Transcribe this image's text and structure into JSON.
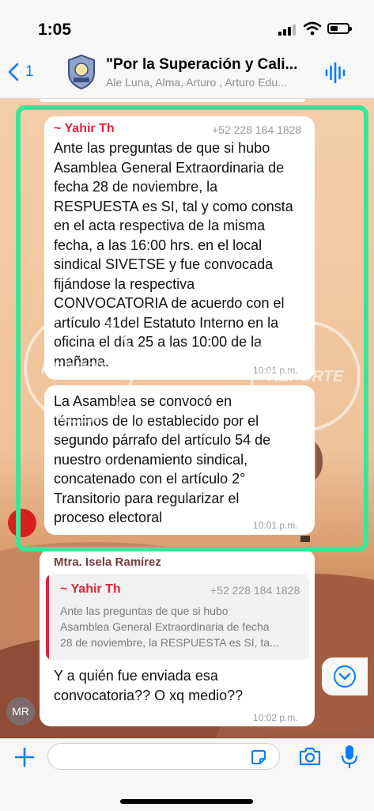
{
  "status_bar": {
    "time": "1:05"
  },
  "header": {
    "back_count": "1",
    "group_title": "\"Por la Superación y Cali...",
    "members": "Ale Luna, Alma, Arturo , Arturo Edu..."
  },
  "messages": {
    "m1": {
      "sender": "~ Yahir Th",
      "phone": "+52 228 184 1828",
      "text": "Ante las preguntas de que si hubo\nAsamblea General Extraordinaria de\nfecha 28 de noviembre, la\nRESPUESTA es SI, tal y como consta\nen el acta respectiva de la misma\nfecha,  a las 16:00 hrs. en el local\nsindical SIVETSE y fue convocada\nfijándose la respectiva\nCONVOCATORIA de acuerdo con el\nartículo 41del Estatuto Interno  en la\noficina el día 25 a las 10:00 de la\nmañana.",
      "time": "10:01 p.m."
    },
    "m2": {
      "text": "La Asamblea se convocó en\ntérminos de lo establecido por el\nsegundo párrafo del artículo 54 de\nnuestro ordenamiento sindical,\nconcatenado con el artículo 2°\nTransitorio para regularizar el\nproceso electoral",
      "time": "10:01 p.m."
    },
    "m3": {
      "sender": "Mtra. Isela Ramírez",
      "quoted_sender": "~ Yahir Th",
      "quoted_phone": "+52 228 184 1828",
      "quoted_text": "Ante las preguntas de que si hubo\nAsamblea General Extraordinaria de fecha\n28 de noviembre, la RESPUESTA es SI, ta...",
      "text": "Y a quién fue enviada esa\nconvocatoria?? O xq medio??",
      "time": "10:02 p.m.",
      "avatar_initials": "MR"
    }
  },
  "colors": {
    "accent": "#0a7cff",
    "sender_red": "#e0243a",
    "sender_brown": "#7a3b3b",
    "highlight": "#3ee39a"
  }
}
